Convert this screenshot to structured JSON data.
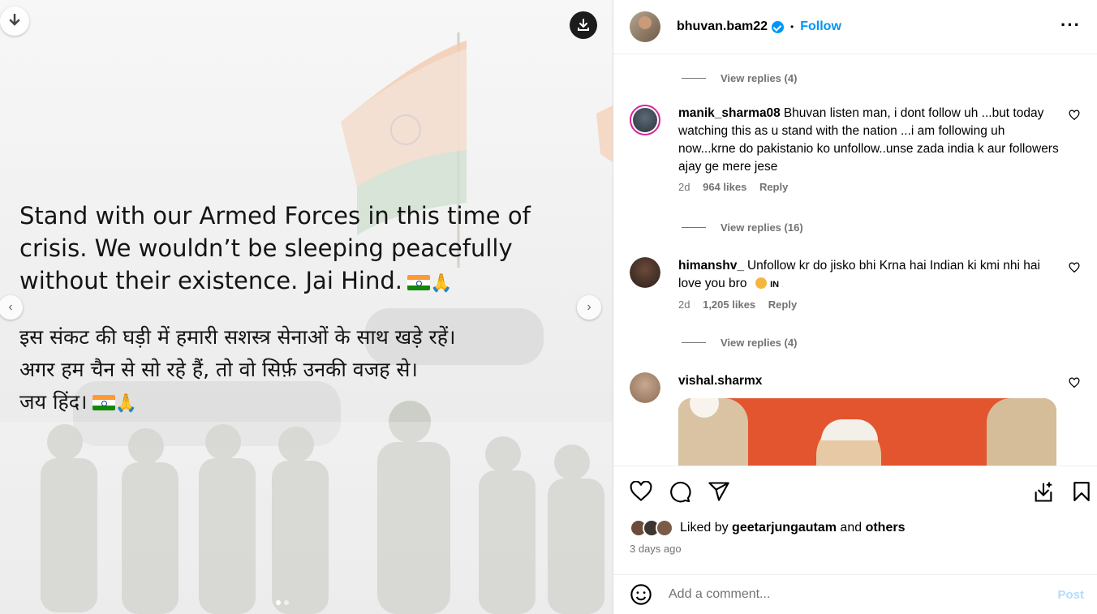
{
  "post": {
    "caption_en": "Stand with our Armed Forces in this time of crisis. We wouldn’t be sleeping peacefully without their existence. Jai Hind.",
    "caption_hi_line1": "इस संकट की घड़ी में हमारी सशस्त्र सेनाओं के साथ खड़े रहें।",
    "caption_hi_line2": "अगर हम चैन से सो रहे हैं, तो वो सिर्फ़ उनकी वजह से।",
    "caption_hi_line3": "जय हिंद।"
  },
  "header": {
    "username": "bhuvan.bam22",
    "separator": "•",
    "follow_label": "Follow",
    "more_label": "···"
  },
  "comments": {
    "view_replies_1": "View replies (4)",
    "c1": {
      "user": "manik_sharma08",
      "text": "Bhuvan listen man, i dont follow uh ...but today watching this as u stand with the nation ...i am following uh now...krne do pakistanio ko unfollow..unse zada india k aur followers ajay ge mere jese",
      "age": "2d",
      "likes": "964 likes",
      "reply": "Reply"
    },
    "view_replies_2": "View replies (16)",
    "c2": {
      "user": "himanshv_",
      "text": "Unfollow kr do jisko bhi Krna hai Indian ki kmi nhi hai love you bro",
      "flag_text": "IN",
      "age": "2d",
      "likes": "1,205 likes",
      "reply": "Reply"
    },
    "view_replies_3": "View replies (4)",
    "c3": {
      "user": "vishal.sharmx"
    }
  },
  "footer": {
    "liked_by_prefix": "Liked by",
    "liked_by_user": "geetarjungautam",
    "liked_and": "and",
    "liked_others": "others",
    "date": "3 days ago",
    "comment_placeholder": "Add a comment...",
    "post_label": "Post"
  },
  "colors": {
    "accent": "#0095f6",
    "muted": "#737373",
    "post_disabled": "#b3dbff"
  }
}
